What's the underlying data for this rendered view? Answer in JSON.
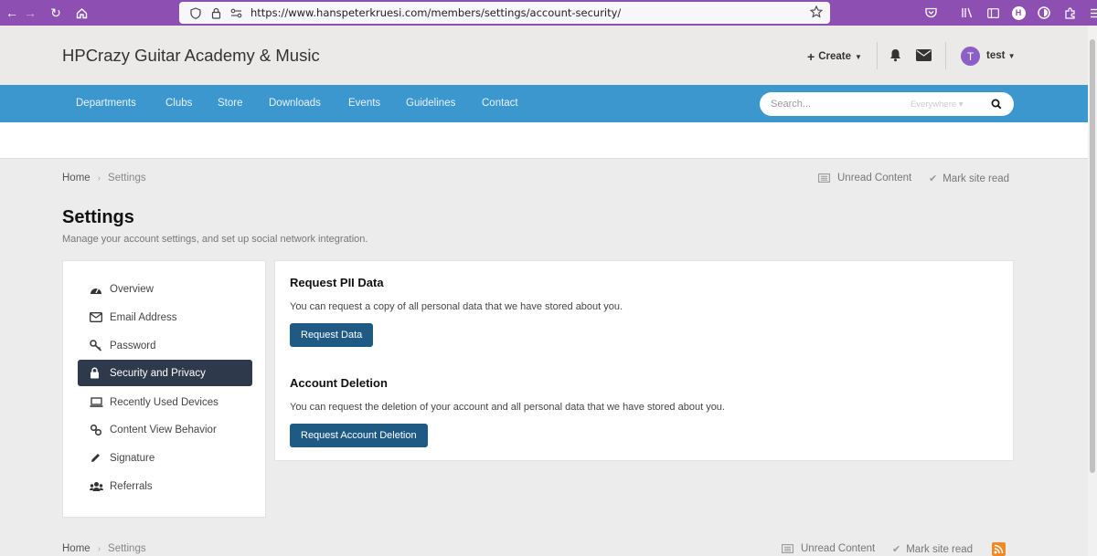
{
  "browser": {
    "url": "https://www.hanspeterkruesi.com/members/settings/account-security/"
  },
  "header": {
    "site_title": "HPCrazy Guitar Academy & Music",
    "create_label": "Create",
    "avatar_letter": "T",
    "user_name": "test"
  },
  "nav": {
    "items": [
      "Departments",
      "Clubs",
      "Store",
      "Downloads",
      "Events",
      "Guidelines",
      "Contact"
    ],
    "search_placeholder": "Search...",
    "search_scope": "Everywhere"
  },
  "breadcrumb": {
    "home": "Home",
    "current": "Settings"
  },
  "top_links": {
    "unread": "Unread Content",
    "mark_read": "Mark site read"
  },
  "page": {
    "title": "Settings",
    "description": "Manage your account settings, and set up social network integration."
  },
  "sidebar": {
    "items": [
      {
        "label": "Overview",
        "icon": "dashboard-icon"
      },
      {
        "label": "Email Address",
        "icon": "envelope-icon"
      },
      {
        "label": "Password",
        "icon": "key-icon"
      },
      {
        "label": "Security and Privacy",
        "icon": "lock-icon",
        "active": true
      },
      {
        "label": "Recently Used Devices",
        "icon": "laptop-icon"
      },
      {
        "label": "Content View Behavior",
        "icon": "link-icon"
      },
      {
        "label": "Signature",
        "icon": "pencil-icon"
      },
      {
        "label": "Referrals",
        "icon": "users-icon"
      }
    ]
  },
  "sections": {
    "pii": {
      "title": "Request PII Data",
      "text": "You can request a copy of all personal data that we have stored about you.",
      "button": "Request Data"
    },
    "deletion": {
      "title": "Account Deletion",
      "text": "You can request the deletion of your account and all personal data that we have stored about you.",
      "button": "Request Account Deletion"
    }
  },
  "colors": {
    "browser_bar": "#8e4fb3",
    "nav_bar": "#3c97cf",
    "active_item": "#2e3a4b",
    "button": "#1f5a85",
    "rss": "#f08a24"
  }
}
